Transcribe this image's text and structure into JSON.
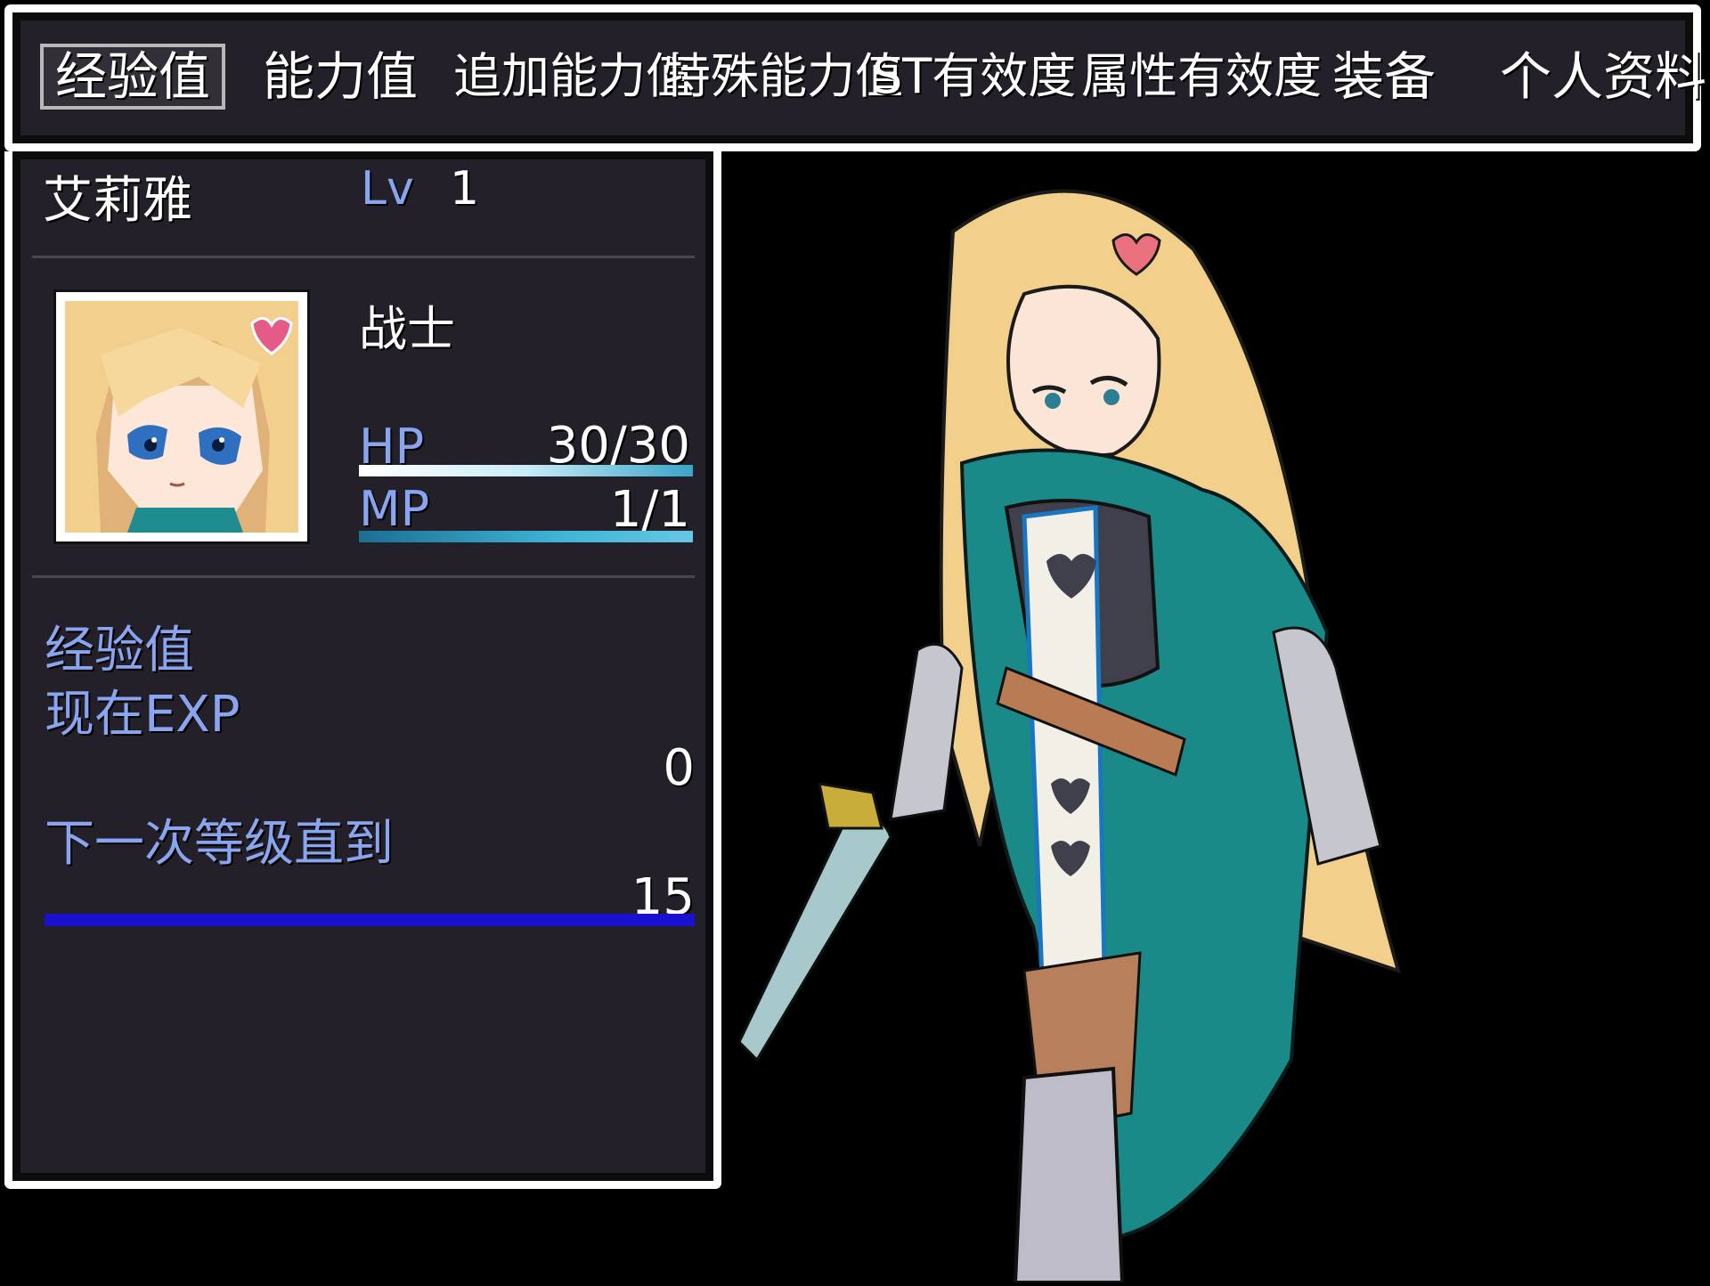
{
  "menu": {
    "tabs": [
      {
        "label": "经验值",
        "selected": true
      },
      {
        "label": "能力值",
        "selected": false
      },
      {
        "label": "追加能力值",
        "selected": false
      },
      {
        "label": "特殊能力值",
        "selected": false
      },
      {
        "label": "ST有效度",
        "selected": false
      },
      {
        "label": "属性有效度",
        "selected": false
      },
      {
        "label": "装备",
        "selected": false
      },
      {
        "label": "个人资料",
        "selected": false
      }
    ]
  },
  "actor": {
    "name": "艾莉雅",
    "level_label": "Lv",
    "level": "1",
    "class": "战士",
    "hp_label": "HP",
    "hp": "30/30",
    "hp_fraction": 1.0,
    "mp_label": "MP",
    "mp": "1/1",
    "mp_fraction": 1.0
  },
  "exp": {
    "heading": "经验值",
    "current_label": "现在EXP",
    "current_value": "0",
    "next_label": "下一次等级直到",
    "next_value": "15",
    "progress_fraction": 0.0
  },
  "colors": {
    "window": "#242029",
    "system_text": "#8aa5ef",
    "exp_gauge": "#1a10d0"
  }
}
